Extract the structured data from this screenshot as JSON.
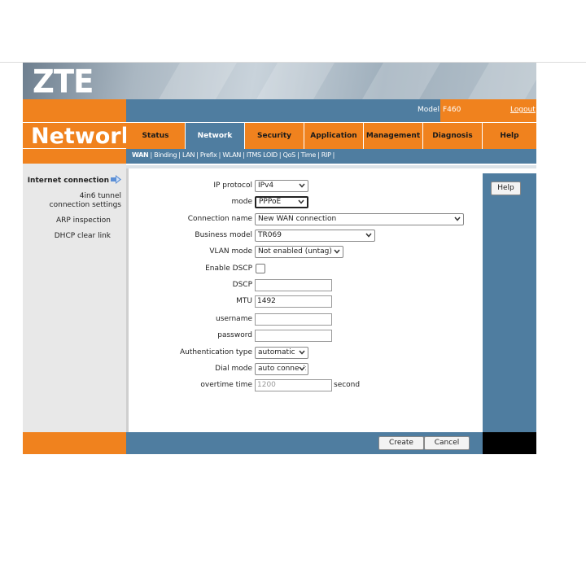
{
  "brand": {
    "logo_text": "ZTE"
  },
  "section_title": "Network",
  "model": {
    "label": "Model:",
    "value": "F460",
    "logout": "Logout"
  },
  "nav": {
    "tabs": [
      {
        "label": "Status"
      },
      {
        "label": "Network"
      },
      {
        "label": "Security"
      },
      {
        "label": "Application"
      },
      {
        "label": "Management"
      },
      {
        "label": "Diagnosis"
      },
      {
        "label": "Help"
      }
    ],
    "active": "Network"
  },
  "subnav": {
    "items": [
      "WAN",
      "Binding",
      "LAN",
      "Prefix",
      "WLAN",
      "ITMS LOID",
      "QoS",
      "Time",
      "RIP"
    ],
    "active": "WAN"
  },
  "sidebar": {
    "items": [
      {
        "label": "Internet connection"
      },
      {
        "label": "4in6 tunnel connection settings"
      },
      {
        "label": "ARP inspection"
      },
      {
        "label": "DHCP clear link"
      }
    ]
  },
  "form": {
    "ip_protocol": {
      "label": "IP protocol",
      "value": "IPv4"
    },
    "mode": {
      "label": "mode",
      "value": "PPPoE"
    },
    "connection_name": {
      "label": "Connection name",
      "value": "New WAN connection"
    },
    "business_model": {
      "label": "Business model",
      "value": "TR069"
    },
    "vlan_mode": {
      "label": "VLAN mode",
      "value": "Not enabled (untag)"
    },
    "enable_dscp": {
      "label": "Enable DSCP",
      "checked": false
    },
    "dscp": {
      "label": "DSCP",
      "value": ""
    },
    "mtu": {
      "label": "MTU",
      "value": "1492"
    },
    "username": {
      "label": "username",
      "value": ""
    },
    "password": {
      "label": "password",
      "value": ""
    },
    "auth_type": {
      "label": "Authentication type",
      "value": "automatic"
    },
    "dial_mode": {
      "label": "Dial mode",
      "value": "auto connect"
    },
    "overtime": {
      "label": "overtime time",
      "value": "1200",
      "unit": "second"
    }
  },
  "buttons": {
    "create": "Create",
    "cancel": "Cancel",
    "help": "Help"
  },
  "colors": {
    "orange": "#f0821e",
    "steel_blue": "#4f7da0",
    "sidebar_gray": "#e8e8e8"
  }
}
